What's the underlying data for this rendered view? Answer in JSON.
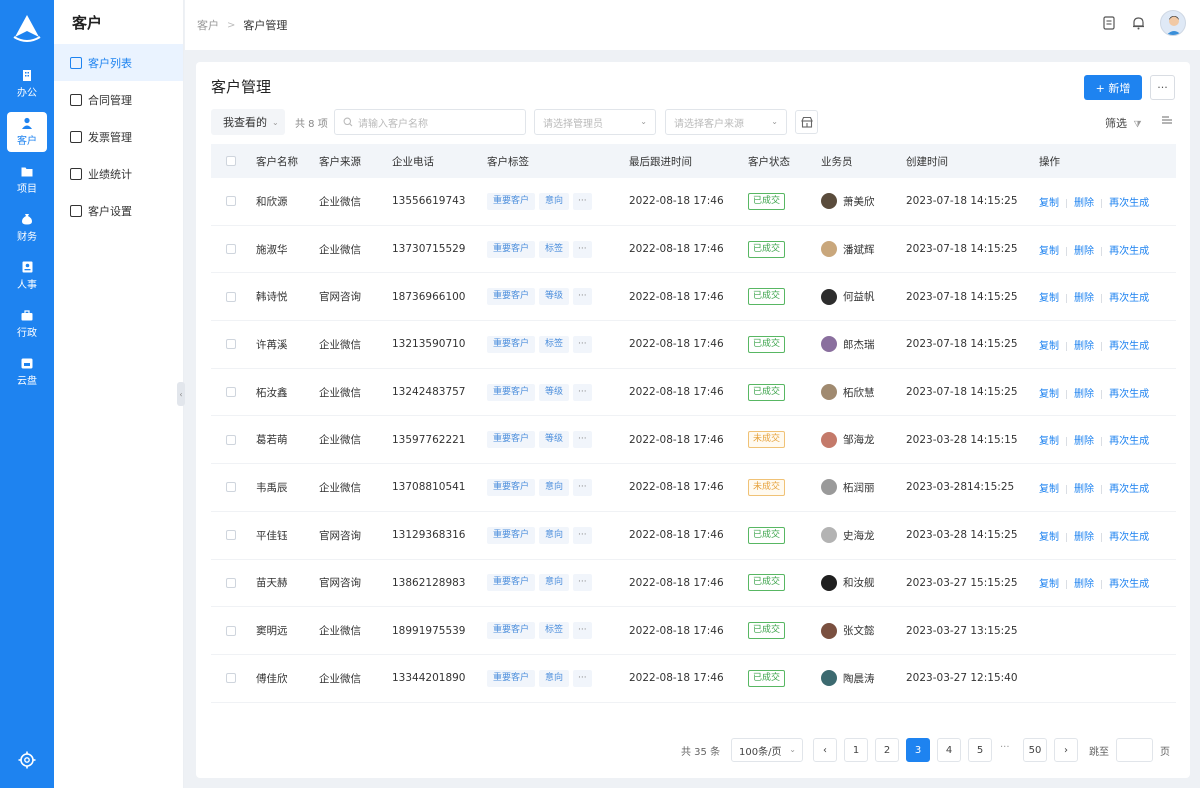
{
  "rail": {
    "items": [
      {
        "label": "办公",
        "icon": "building-icon"
      },
      {
        "label": "客户",
        "icon": "user-icon"
      },
      {
        "label": "项目",
        "icon": "folder-icon"
      },
      {
        "label": "财务",
        "icon": "money-bag-icon"
      },
      {
        "label": "人事",
        "icon": "id-card-icon"
      },
      {
        "label": "行政",
        "icon": "briefcase-icon"
      },
      {
        "label": "云盘",
        "icon": "cloud-drive-icon"
      }
    ],
    "active_index": 1
  },
  "submenu": {
    "title": "客户",
    "items": [
      {
        "label": "客户列表"
      },
      {
        "label": "合同管理"
      },
      {
        "label": "发票管理"
      },
      {
        "label": "业绩统计"
      },
      {
        "label": "客户设置"
      }
    ],
    "active_index": 0
  },
  "breadcrumb": {
    "root": "客户",
    "current": "客户管理"
  },
  "page": {
    "title": "客户管理",
    "new_button": "+ 新增",
    "more_button": "···"
  },
  "filters": {
    "scope": "我查看的",
    "total_label": "共 8 项",
    "search_placeholder": "请输入客户名称",
    "manager_placeholder": "请选择管理员",
    "source_placeholder": "请选择客户来源",
    "filter_label": "筛选"
  },
  "table": {
    "headers": [
      "客户名称",
      "客户来源",
      "企业电话",
      "客户标签",
      "最后跟进时间",
      "客户状态",
      "业务员",
      "创建时间",
      "操作"
    ],
    "ops": {
      "copy": "复制",
      "delete": "删除",
      "regen": "再次生成"
    },
    "more_tag": "···",
    "rows": [
      {
        "name": "和欣源",
        "source": "企业微信",
        "phone": "13556619743",
        "tags": [
          "重要客户",
          "意向"
        ],
        "last": "2022-08-18 17:46",
        "status": "已成交",
        "status_type": "done",
        "sales": "萧美欣",
        "avatar_color": "#5a4c3c",
        "created": "2023-07-18 14:15:25",
        "has_ops": true
      },
      {
        "name": "施淑华",
        "source": "企业微信",
        "phone": "13730715529",
        "tags": [
          "重要客户",
          "标签"
        ],
        "last": "2022-08-18 17:46",
        "status": "已成交",
        "status_type": "done",
        "sales": "潘斌辉",
        "avatar_color": "#c9a77c",
        "created": "2023-07-18 14:15:25",
        "has_ops": true
      },
      {
        "name": "韩诗悦",
        "source": "官网咨询",
        "phone": "18736966100",
        "tags": [
          "重要客户",
          "等级"
        ],
        "last": "2022-08-18 17:46",
        "status": "已成交",
        "status_type": "done",
        "sales": "何益帆",
        "avatar_color": "#2d2d2d",
        "created": "2023-07-18 14:15:25",
        "has_ops": true
      },
      {
        "name": "许苒溪",
        "source": "企业微信",
        "phone": "13213590710",
        "tags": [
          "重要客户",
          "标签"
        ],
        "last": "2022-08-18 17:46",
        "status": "已成交",
        "status_type": "done",
        "sales": "郎杰瑞",
        "avatar_color": "#8a6f9e",
        "created": "2023-07-18 14:15:25",
        "has_ops": true
      },
      {
        "name": "柘汝鑫",
        "source": "企业微信",
        "phone": "13242483757",
        "tags": [
          "重要客户",
          "等级"
        ],
        "last": "2022-08-18 17:46",
        "status": "已成交",
        "status_type": "done",
        "sales": "柘欣慧",
        "avatar_color": "#a08a70",
        "created": "2023-07-18 14:15:25",
        "has_ops": true
      },
      {
        "name": "葛若萌",
        "source": "企业微信",
        "phone": "13597762221",
        "tags": [
          "重要客户",
          "等级"
        ],
        "last": "2022-08-18 17:46",
        "status": "未成交",
        "status_type": "undone",
        "sales": "邹海龙",
        "avatar_color": "#c47a6a",
        "created": "2023-03-28 14:15:15",
        "has_ops": true
      },
      {
        "name": "韦禹辰",
        "source": "企业微信",
        "phone": "13708810541",
        "tags": [
          "重要客户",
          "意向"
        ],
        "last": "2022-08-18 17:46",
        "status": "未成交",
        "status_type": "undone",
        "sales": "柘润丽",
        "avatar_color": "#9a9a9a",
        "created": "2023-03-2814:15:25",
        "has_ops": true
      },
      {
        "name": "平佳钰",
        "source": "官网咨询",
        "phone": "13129368316",
        "tags": [
          "重要客户",
          "意向"
        ],
        "last": "2022-08-18 17:46",
        "status": "已成交",
        "status_type": "done",
        "sales": "史海龙",
        "avatar_color": "#b3b3b3",
        "created": "2023-03-28 14:15:25",
        "has_ops": true
      },
      {
        "name": "苗天赫",
        "source": "官网咨询",
        "phone": "13862128983",
        "tags": [
          "重要客户",
          "意向"
        ],
        "last": "2022-08-18 17:46",
        "status": "已成交",
        "status_type": "done",
        "sales": "和汝舰",
        "avatar_color": "#1f1f1f",
        "created": "2023-03-27 15:15:25",
        "has_ops": true
      },
      {
        "name": "窦明远",
        "source": "企业微信",
        "phone": "18991975539",
        "tags": [
          "重要客户",
          "标签"
        ],
        "last": "2022-08-18 17:46",
        "status": "已成交",
        "status_type": "done",
        "sales": "张文懿",
        "avatar_color": "#7a5040",
        "created": "2023-03-27 13:15:25",
        "has_ops": false
      },
      {
        "name": "傅佳欣",
        "source": "企业微信",
        "phone": "13344201890",
        "tags": [
          "重要客户",
          "意向"
        ],
        "last": "2022-08-18 17:46",
        "status": "已成交",
        "status_type": "done",
        "sales": "陶晨涛",
        "avatar_color": "#3c6a70",
        "created": "2023-03-27 12:15:40",
        "has_ops": false
      }
    ]
  },
  "pagination": {
    "total": "共 35 条",
    "page_size": "100条/页",
    "pages": [
      "1",
      "2",
      "3",
      "4",
      "5"
    ],
    "current": "3",
    "ellipsis": "···",
    "last": "50",
    "jump_label": "跳至",
    "page_unit": "页"
  },
  "colors": {
    "primary": "#1e83f0",
    "done": "#3ba34a",
    "undone": "#e6a23c"
  }
}
